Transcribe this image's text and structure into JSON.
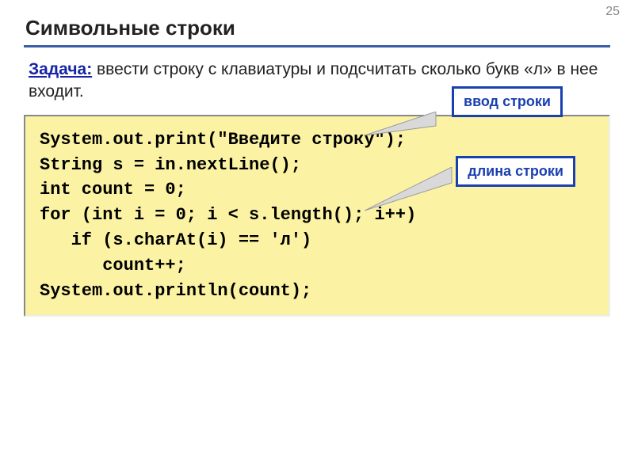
{
  "page_number": "25",
  "title": "Символьные строки",
  "task": {
    "label": "Задача:",
    "text": " ввести строку с клавиатуры и подсчитать сколько букв «л» в нее входит."
  },
  "code": {
    "line1": "System.out.print(\"Введите строку\");",
    "line2": "String s = in.nextLine();",
    "line3": "int count = 0;",
    "line4": "for (int i = 0; i < s.length(); i++)",
    "line5": "   if (s.charAt(i) == 'л')",
    "line6": "      count++;",
    "line7": "System.out.println(count);"
  },
  "callouts": {
    "input": "ввод строки",
    "length": "длина строки"
  }
}
